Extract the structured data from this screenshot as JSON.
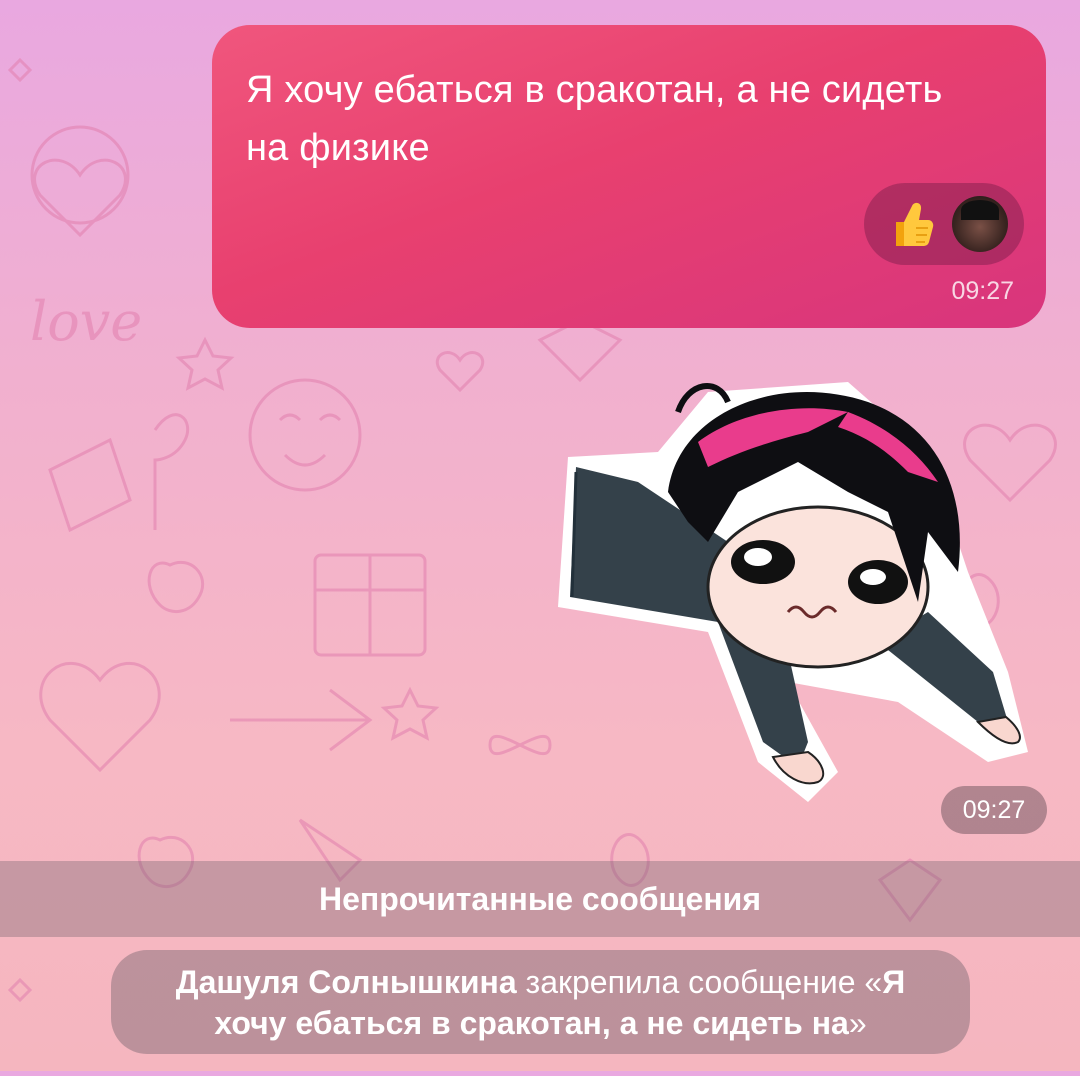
{
  "message": {
    "text": "Я хочу ебаться в сракотан, а не сидеть на физике",
    "time": "09:27",
    "reactions": [
      {
        "type": "emoji",
        "icon": "thumbs-up"
      },
      {
        "type": "avatar",
        "icon": "user-avatar"
      }
    ]
  },
  "sticker": {
    "time": "09:27"
  },
  "unread_divider": {
    "label": "Непрочитанные сообщения"
  },
  "service_message": {
    "actor": "Дашуля Солнышкина",
    "action": " закрепила сообщение «",
    "quote": "Я хочу ебаться в сракотан, а не сидеть на",
    "close": "»"
  },
  "colors": {
    "bubble_start": "#f0567d",
    "bubble_end": "#d8357d",
    "background_top": "#e9a8e0",
    "background_bottom": "#f5b6bf"
  }
}
